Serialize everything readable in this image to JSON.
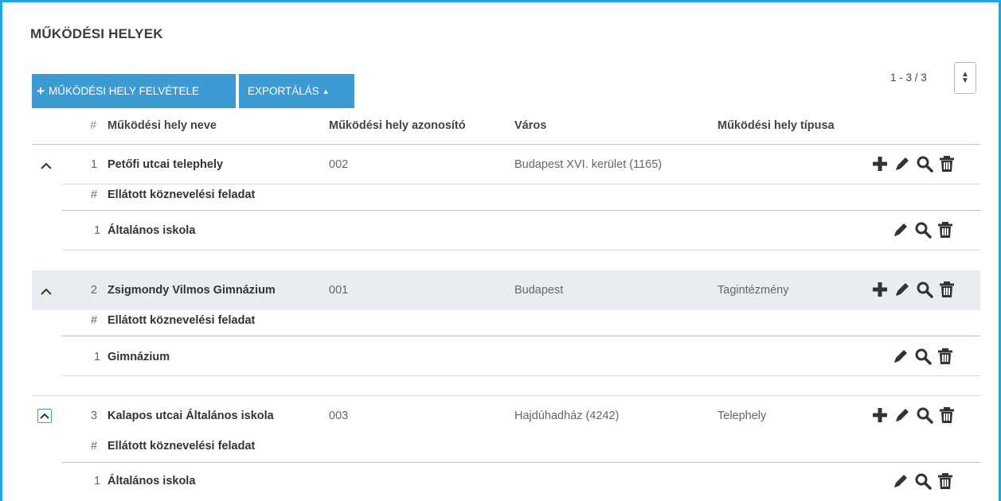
{
  "page": {
    "title": "MŰKÖDÉSI HELYEK",
    "add_button": "MŰKÖDÉSI HELY FELVÉTELE",
    "export_button": "EXPORTÁLÁS",
    "pager": "1 - 3 / 3"
  },
  "table": {
    "headers": {
      "hash": "#",
      "name": "Működési hely neve",
      "id": "Működési hely azonosító",
      "city": "Város",
      "type": "Működési hely típusa"
    },
    "sub_header": "Ellátott köznevelési feladat",
    "rows": [
      {
        "num": "1",
        "name": "Petőfi utcai telephely",
        "id": "002",
        "city": "Budapest XVI. kerület (1165)",
        "type": "",
        "task_num": "1",
        "task": "Általános iskola"
      },
      {
        "num": "2",
        "name": "Zsigmondy Vilmos Gimnázium",
        "id": "001",
        "city": "Budapest",
        "type": "Tagintézmény",
        "task_num": "1",
        "task": "Gimnázium"
      },
      {
        "num": "3",
        "name": "Kalapos utcai Általános iskola",
        "id": "003",
        "city": "Hajdúhadház (4242)",
        "type": "Telephely",
        "task_num": "1",
        "task": "Általános iskola"
      }
    ]
  },
  "colors": {
    "accent": "#1ea7e1",
    "button": "#3d9bd4",
    "row_highlight": "#e9edf1"
  }
}
